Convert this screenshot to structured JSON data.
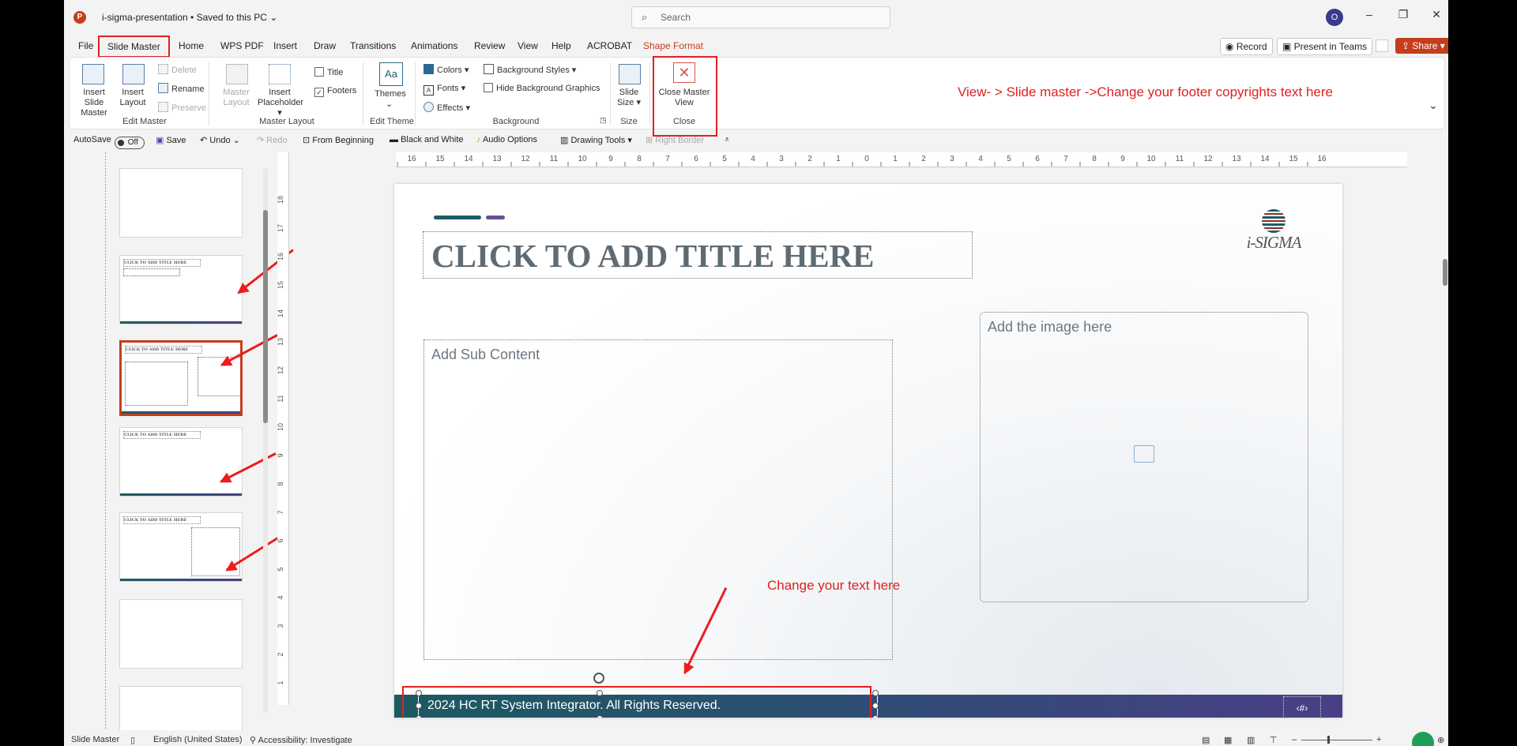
{
  "titlebar": {
    "doc_title": "i-sigma-presentation • Saved to this PC ⌄",
    "search_placeholder": "Search",
    "avatar_initial": "O"
  },
  "menu": {
    "tabs": [
      "File",
      "Slide Master",
      "Home",
      "WPS PDF",
      "Insert",
      "Draw",
      "Transitions",
      "Animations",
      "Review",
      "View",
      "Help",
      "ACROBAT",
      "Shape Format"
    ],
    "active": "Slide Master",
    "record": "Record",
    "present": "Present in Teams",
    "share": "Share"
  },
  "ribbon": {
    "insert_slide_master": "Insert Slide Master",
    "insert_layout": "Insert Layout",
    "delete": "Delete",
    "rename": "Rename",
    "preserve": "Preserve",
    "edit_master_group": "Edit Master",
    "master_layout_btn": "Master Layout",
    "insert_placeholder": "Insert Placeholder",
    "title_check": "Title",
    "footers_check": "Footers",
    "master_layout_group": "Master Layout",
    "themes": "Themes",
    "edit_theme_group": "Edit Theme",
    "colors": "Colors",
    "fonts": "Fonts",
    "effects": "Effects",
    "background_styles": "Background Styles",
    "hide_background": "Hide Background Graphics",
    "background_group": "Background",
    "slide_size": "Slide Size",
    "size_group": "Size",
    "close_master": "Close Master View",
    "close_group": "Close"
  },
  "annotations": {
    "ribbon_note": "View- > Slide master ->Change your footer copyrights text here",
    "footer_note": "Change your text here"
  },
  "qat": {
    "autosave": "AutoSave",
    "autosave_state": "Off",
    "save": "Save",
    "undo": "Undo",
    "redo": "Redo",
    "from_beginning": "From Beginning",
    "black_white": "Black and White",
    "audio_options": "Audio Options",
    "drawing_tools": "Drawing Tools",
    "right_border": "Right Border"
  },
  "ruler": {
    "h_ticks": [
      "16",
      "15",
      "14",
      "13",
      "12",
      "11",
      "10",
      "9",
      "8",
      "7",
      "6",
      "5",
      "4",
      "3",
      "2",
      "1",
      "0",
      "1",
      "2",
      "3",
      "4",
      "5",
      "6",
      "7",
      "8",
      "9",
      "10",
      "11",
      "12",
      "13",
      "14",
      "15",
      "16"
    ],
    "v_ticks": [
      "18",
      "17",
      "16",
      "15",
      "14",
      "13",
      "12",
      "11",
      "10",
      "9",
      "8",
      "7",
      "6",
      "5",
      "4",
      "3",
      "2",
      "1"
    ]
  },
  "thumbnails": {
    "thumb_title": "CLICK TO ADD TITLE HERE"
  },
  "slide": {
    "title": "CLICK TO ADD TITLE HERE",
    "logo": "i-SIGMA",
    "sub_content": "Add Sub Content",
    "image_placeholder": "Add the image here",
    "footer": "2024 HC RT System Integrator. All Rights Reserved.",
    "page_number": "‹#›"
  },
  "status": {
    "view": "Slide Master",
    "language": "English (United States)",
    "accessibility": "Accessibility: Investigate"
  },
  "colors": {
    "accent": "#c43e1c",
    "annotation": "#e02020",
    "footer_start": "#1c5a62",
    "footer_end": "#4a3f86"
  }
}
